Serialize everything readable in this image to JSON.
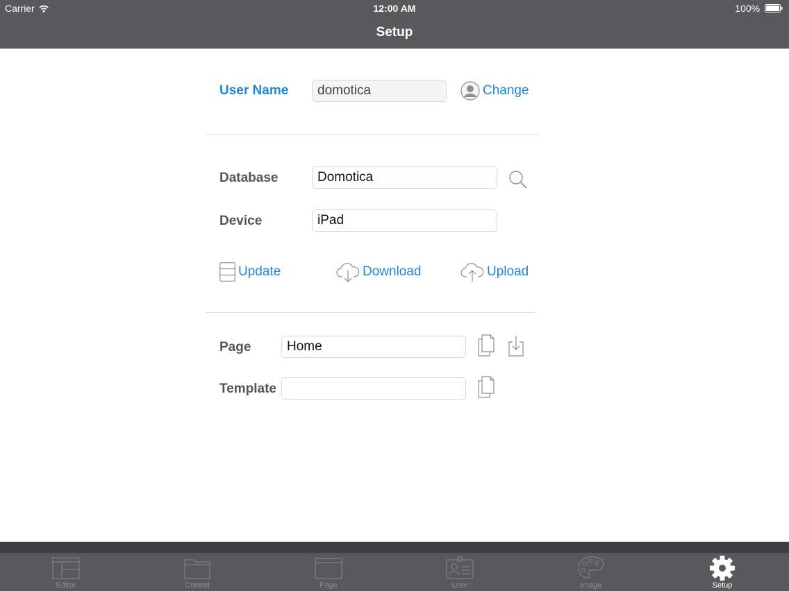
{
  "status_bar": {
    "carrier": "Carrier",
    "time": "12:00 AM",
    "battery": "100%"
  },
  "nav": {
    "title": "Setup"
  },
  "user": {
    "label": "User Name",
    "value": "domotica",
    "change_label": "Change"
  },
  "database": {
    "label": "Database",
    "value": "Domotica"
  },
  "device": {
    "label": "Device",
    "value": "iPad"
  },
  "actions": {
    "update": "Update",
    "download": "Download",
    "upload": "Upload"
  },
  "page": {
    "label": "Page",
    "value": "Home"
  },
  "template": {
    "label": "Template",
    "value": ""
  },
  "tabs": [
    {
      "label": "Editor",
      "icon": "editor-icon"
    },
    {
      "label": "Control",
      "icon": "folder-icon"
    },
    {
      "label": "Page",
      "icon": "page-icon"
    },
    {
      "label": "User",
      "icon": "user-card-icon"
    },
    {
      "label": "Image",
      "icon": "palette-icon"
    },
    {
      "label": "Setup",
      "icon": "gear-icon",
      "active": true
    }
  ],
  "colors": {
    "nav": "#59595c",
    "accent": "#1e88d6",
    "label": "#555555"
  }
}
